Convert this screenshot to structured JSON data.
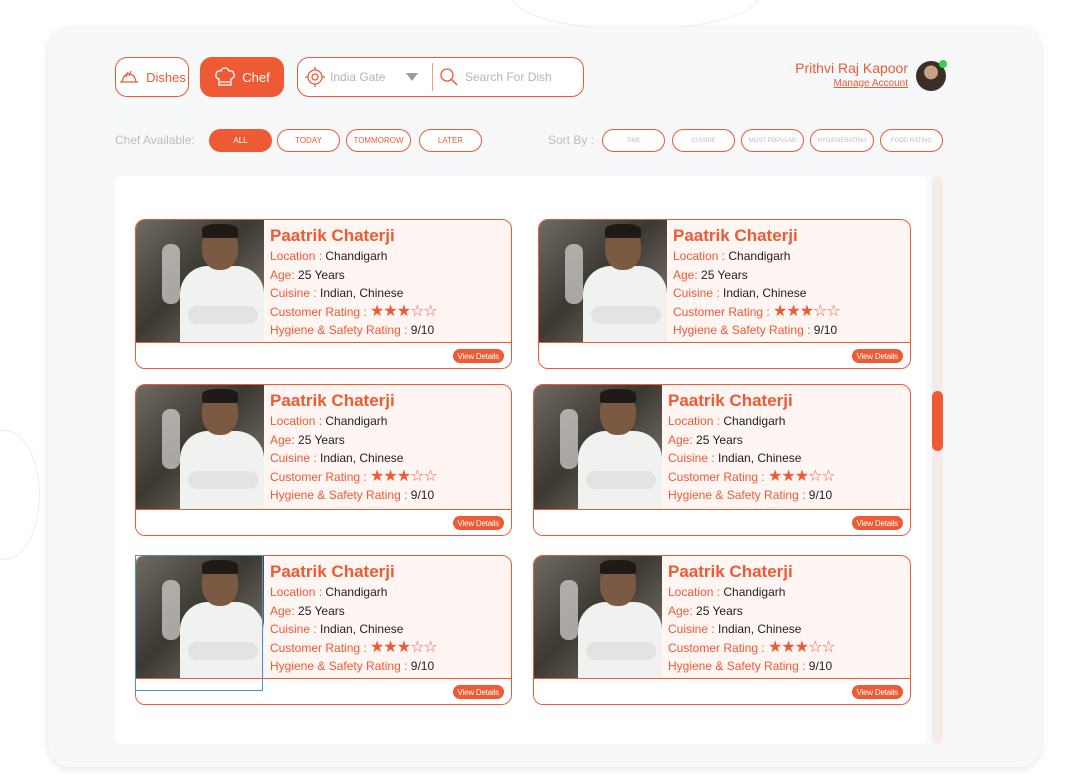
{
  "nav": {
    "dishes_label": "Dishes",
    "chef_label": "Chef"
  },
  "location": {
    "value": "India Gate"
  },
  "search": {
    "placeholder": "Search For Dish"
  },
  "user": {
    "name": "Prithvi Raj Kapoor",
    "manage_label": "Manage Account",
    "online": true
  },
  "filters": {
    "available_label": "Chef Available:",
    "available_options": [
      "ALL",
      "TODAY",
      "TOMMOROW",
      "LATER"
    ],
    "available_selected": "ALL",
    "sort_label": "Sort By :",
    "sort_options": [
      "TIME",
      "CUISINE",
      "MOST POPULAR",
      "HYGIENERATING",
      "FOOD RATING"
    ]
  },
  "colors": {
    "accent": "#ee5a33",
    "card_bg": "#fff5f3",
    "panel_bg": "#f7f8fa"
  },
  "chefs": [
    {
      "name": "Paatrik Chaterji",
      "location_label": "Location :",
      "location": "Chandigarh",
      "age_label": "Age:",
      "age": "25 Years",
      "cuisine_label": "Cuisine :",
      "cuisine": "Indian, Chinese",
      "rating_label": "Customer Rating :",
      "rating": 3,
      "rating_max": 5,
      "hygiene_label": "Hygiene & Safety Rating :",
      "hygiene": "9/10",
      "view_label": "View Details"
    },
    {
      "name": "Paatrik Chaterji",
      "location_label": "Location :",
      "location": "Chandigarh",
      "age_label": "Age:",
      "age": "25 Years",
      "cuisine_label": "Cuisine :",
      "cuisine": "Indian, Chinese",
      "rating_label": "Customer Rating :",
      "rating": 3,
      "rating_max": 5,
      "hygiene_label": "Hygiene & Safety Rating :",
      "hygiene": "9/10",
      "view_label": "View Details"
    },
    {
      "name": "Paatrik Chaterji",
      "location_label": "Location :",
      "location": "Chandigarh",
      "age_label": "Age:",
      "age": "25 Years",
      "cuisine_label": "Cuisine :",
      "cuisine": "Indian, Chinese",
      "rating_label": "Customer Rating :",
      "rating": 3,
      "rating_max": 5,
      "hygiene_label": "Hygiene & Safety Rating :",
      "hygiene": "9/10",
      "view_label": "View Details"
    },
    {
      "name": "Paatrik Chaterji",
      "location_label": "Location :",
      "location": "Chandigarh",
      "age_label": "Age:",
      "age": "25 Years",
      "cuisine_label": "Cuisine :",
      "cuisine": "Indian, Chinese",
      "rating_label": "Customer Rating :",
      "rating": 3,
      "rating_max": 5,
      "hygiene_label": "Hygiene & Safety Rating :",
      "hygiene": "9/10",
      "view_label": "View Details"
    },
    {
      "name": "Paatrik Chaterji",
      "location_label": "Location :",
      "location": "Chandigarh",
      "age_label": "Age:",
      "age": "25 Years",
      "cuisine_label": "Cuisine :",
      "cuisine": "Indian, Chinese",
      "rating_label": "Customer Rating :",
      "rating": 3,
      "rating_max": 5,
      "hygiene_label": "Hygiene & Safety Rating :",
      "hygiene": "9/10",
      "view_label": "View Details"
    },
    {
      "name": "Paatrik Chaterji",
      "location_label": "Location :",
      "location": "Chandigarh",
      "age_label": "Age:",
      "age": "25 Years",
      "cuisine_label": "Cuisine :",
      "cuisine": "Indian, Chinese",
      "rating_label": "Customer Rating :",
      "rating": 3,
      "rating_max": 5,
      "hygiene_label": "Hygiene & Safety Rating :",
      "hygiene": "9/10",
      "view_label": "View Details"
    }
  ]
}
